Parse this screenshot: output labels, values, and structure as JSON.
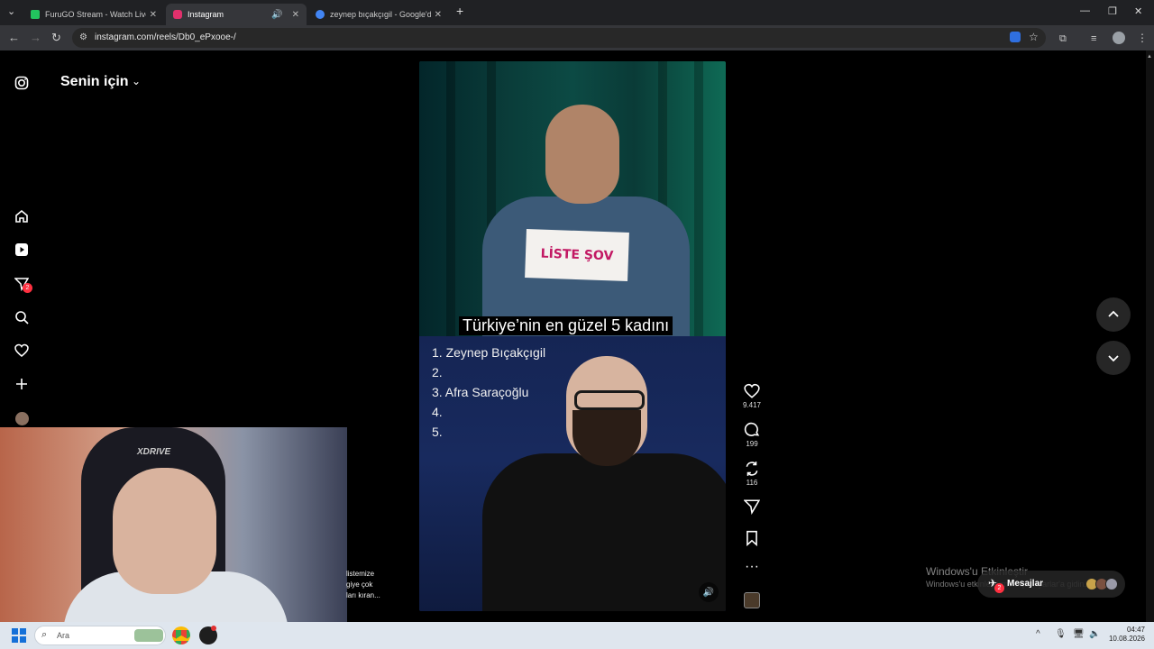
{
  "browser": {
    "tabs": [
      {
        "title": "FuruGO Stream - Watch Live on",
        "favicon_color": "#22c55e",
        "active": false
      },
      {
        "title": "Instagram",
        "favicon_color": "#e1306c",
        "active": true
      },
      {
        "title": "zeynep bıçakçıgil - Google'da A",
        "favicon_color": "#4285f4",
        "active": false
      }
    ],
    "new_tab": "+",
    "url": "instagram.com/reels/Db0_ePxooe-/"
  },
  "sidebar": {
    "brand_title": "Senin için",
    "messages_badge": "2",
    "nav_icons": [
      "instagram-logo-icon",
      "home-icon",
      "reels-icon",
      "messages-icon",
      "search-icon",
      "heart-icon",
      "create-icon",
      "profile-avatar"
    ]
  },
  "reel": {
    "paper_text": "LİSTE ŞOV",
    "caption": "Türkiye’nin en güzel 5 kadını",
    "list": [
      "1. Zeynep Bıçakçıgil",
      "2.",
      "3. Afra Saraçoğlu",
      "4.",
      "5."
    ]
  },
  "actions": {
    "likes": "9.417",
    "comments": "199",
    "shares": "116"
  },
  "description": {
    "line1": "listemize",
    "line2": "giye çok",
    "line3": "ları kıran..."
  },
  "windows": {
    "watermark_title": "Windows'u Etkinleştir",
    "watermark_sub": "Windows'u etkinleştirmek için Ayarlar'a gidin.",
    "messages_label": "Mesajlar",
    "messages_badge": "2"
  },
  "taskbar": {
    "search_placeholder": "Ara",
    "time": "04:47",
    "date": "10.08.2026"
  },
  "colors": {
    "ig_badge": "#ff3040",
    "paper_text": "#c21863",
    "taskbar": "#dfe6ee"
  }
}
